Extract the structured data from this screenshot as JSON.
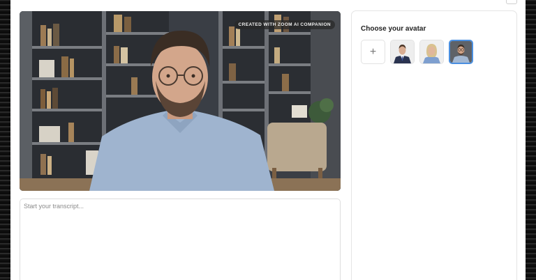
{
  "video": {
    "badge": "CREATED WITH ZOOM AI COMPANION"
  },
  "transcript": {
    "placeholder": "Start your transcript...",
    "value": ""
  },
  "avatar_panel": {
    "title": "Choose your avatar",
    "add_icon": "+",
    "avatars": [
      {
        "name": "avatar-man-suit",
        "selected": false
      },
      {
        "name": "avatar-woman-blonde",
        "selected": false
      },
      {
        "name": "avatar-man-glasses",
        "selected": true
      }
    ]
  },
  "colors": {
    "selected_border": "#4a8fe0",
    "badge_bg": "#282828"
  }
}
